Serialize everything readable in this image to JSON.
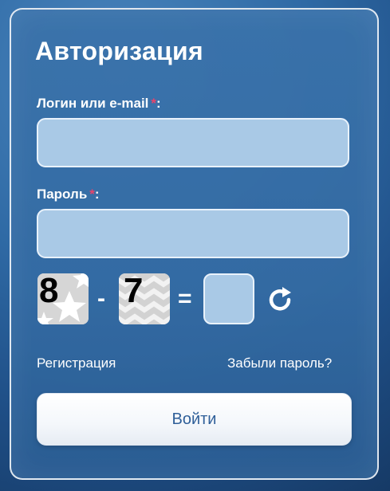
{
  "form": {
    "title": "Авторизация",
    "login_label": "Логин или e-mail",
    "login_required": "*",
    "login_colon": ":",
    "login_value": "",
    "password_label": "Пароль",
    "password_required": "*",
    "password_colon": ":",
    "password_value": ""
  },
  "captcha": {
    "num1": "8",
    "operator": "-",
    "num2": "7",
    "equals": "=",
    "answer_value": "",
    "refresh_icon": "refresh-icon"
  },
  "links": {
    "register": "Регистрация",
    "forgot": "Забыли пароль?"
  },
  "button": {
    "submit": "Войти"
  },
  "colors": {
    "accent_required": "#e9436a",
    "button_text": "#2f5f99",
    "field_bg": "#a9c9e6"
  }
}
